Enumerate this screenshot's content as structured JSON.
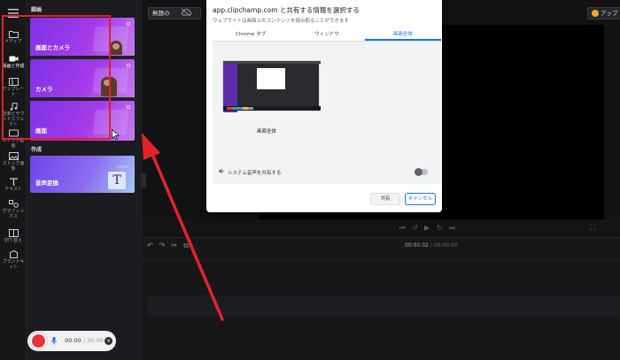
{
  "rail": {
    "items": [
      {
        "icon": "folder-icon",
        "label": "メディア"
      },
      {
        "icon": "camera-icon",
        "label": "録画と作成"
      },
      {
        "icon": "template-icon",
        "label": "テンプレー\nト"
      },
      {
        "icon": "music-icon",
        "label": "音楽とサウ\nンドエフェ\nクト"
      },
      {
        "icon": "stock-video-icon",
        "label": "ストック動\n画"
      },
      {
        "icon": "image-icon",
        "label": "ストック画\n像"
      },
      {
        "icon": "text-icon",
        "label": "テキスト"
      },
      {
        "icon": "graphics-icon",
        "label": "グラフィッ\nクス"
      },
      {
        "icon": "transition-icon",
        "label": "切り替え"
      },
      {
        "icon": "brand-kit-icon",
        "label": "ブランドキ\nット"
      }
    ]
  },
  "panel": {
    "record_title": "録画",
    "create_title": "作成",
    "cards": [
      {
        "label": "画面とカメラ"
      },
      {
        "label": "カメラ"
      },
      {
        "label": "画面"
      }
    ],
    "tts_label": "音声変換",
    "tts_glyph": "T"
  },
  "recorder": {
    "time": "00:00",
    "sep": " / ",
    "max": "30:00",
    "close_glyph": "×"
  },
  "header": {
    "project_title": "無題の",
    "upgrade_label": "アップ"
  },
  "timeline": {
    "current": "00:00.02",
    "sep": " / ",
    "total": "00:00.00",
    "tools": [
      "↶",
      "↷",
      "✂",
      "⧉"
    ]
  },
  "playback": {
    "controls": [
      "⏮",
      "↺",
      "▶",
      "↻",
      "⏭"
    ],
    "expand": "⛶"
  },
  "dialog": {
    "title": "app.clipchamp.com と共有する情報を選択する",
    "subtitle": "ウェブサイトは画面上のコンテンツを読み取ることができます",
    "tabs": [
      "Chrome タブ",
      "ウィンドウ",
      "画面全体"
    ],
    "active_tab": 2,
    "thumbnail_label": "画面全体",
    "audio_label": "システム音声を共有する",
    "share_label": "共有",
    "cancel_label": "キャンセル",
    "accent": "#1a73e8"
  },
  "colors": {
    "highlight": "#e0212d",
    "record": "#e9333d",
    "card_gradient_start": "#7d34e6"
  }
}
